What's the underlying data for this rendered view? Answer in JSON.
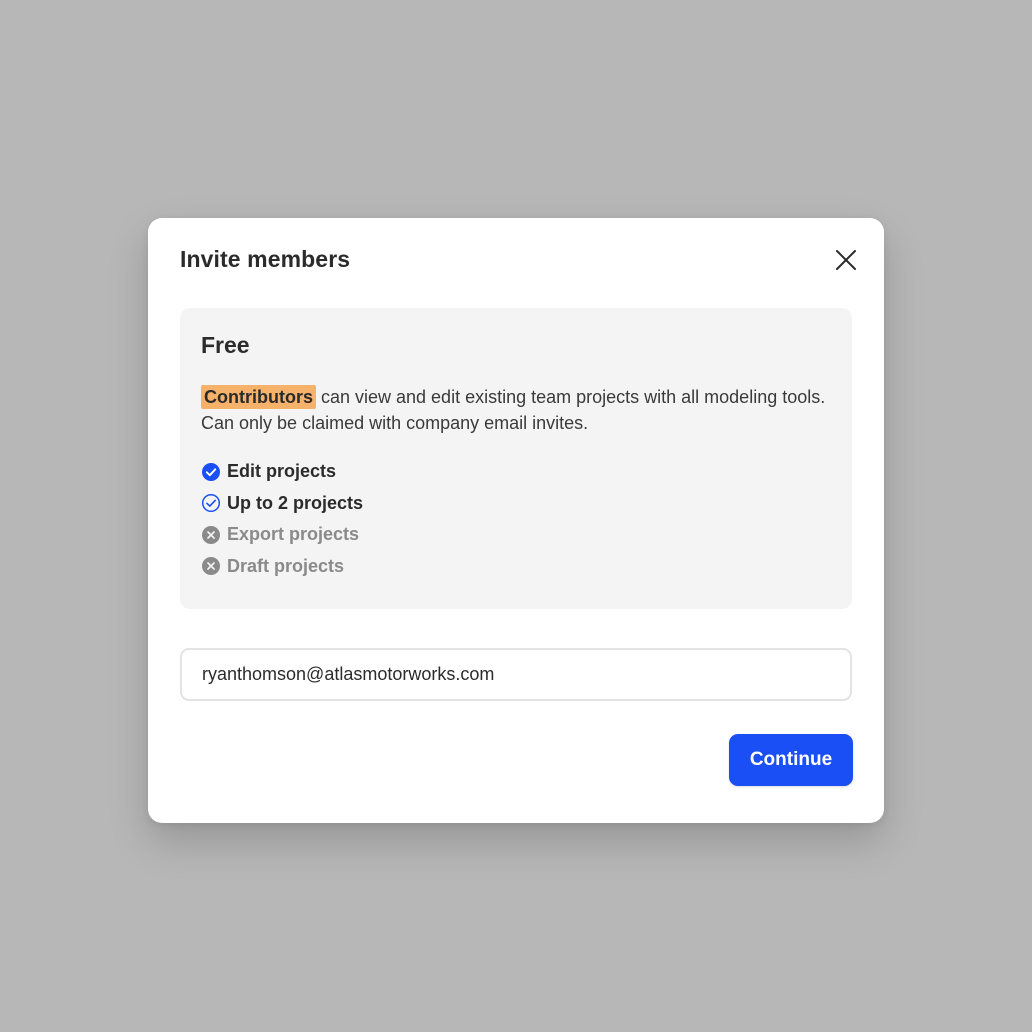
{
  "dialog": {
    "title": "Invite members",
    "close_icon": "close-icon"
  },
  "plan": {
    "name": "Free",
    "role": "Contributors",
    "description": " can view and edit existing team projects with all modeling tools. Can only be claimed with company email invites.",
    "features": [
      {
        "label": "Edit projects",
        "icon": "check-filled-icon",
        "enabled": true
      },
      {
        "label": "Up to 2 projects",
        "icon": "check-outline-icon",
        "enabled": true
      },
      {
        "label": "Export projects",
        "icon": "x-circle-icon",
        "enabled": false
      },
      {
        "label": "Draft projects",
        "icon": "x-circle-icon",
        "enabled": false
      }
    ]
  },
  "email": {
    "value": "ryanthomson@atlasmotorworks.com"
  },
  "actions": {
    "continue_label": "Continue"
  },
  "colors": {
    "backdrop": "#b7b7b7",
    "accent": "#1a4ff5",
    "highlight": "#f6b26b",
    "card": "#f4f4f4",
    "disabled": "#8a8a8a"
  }
}
